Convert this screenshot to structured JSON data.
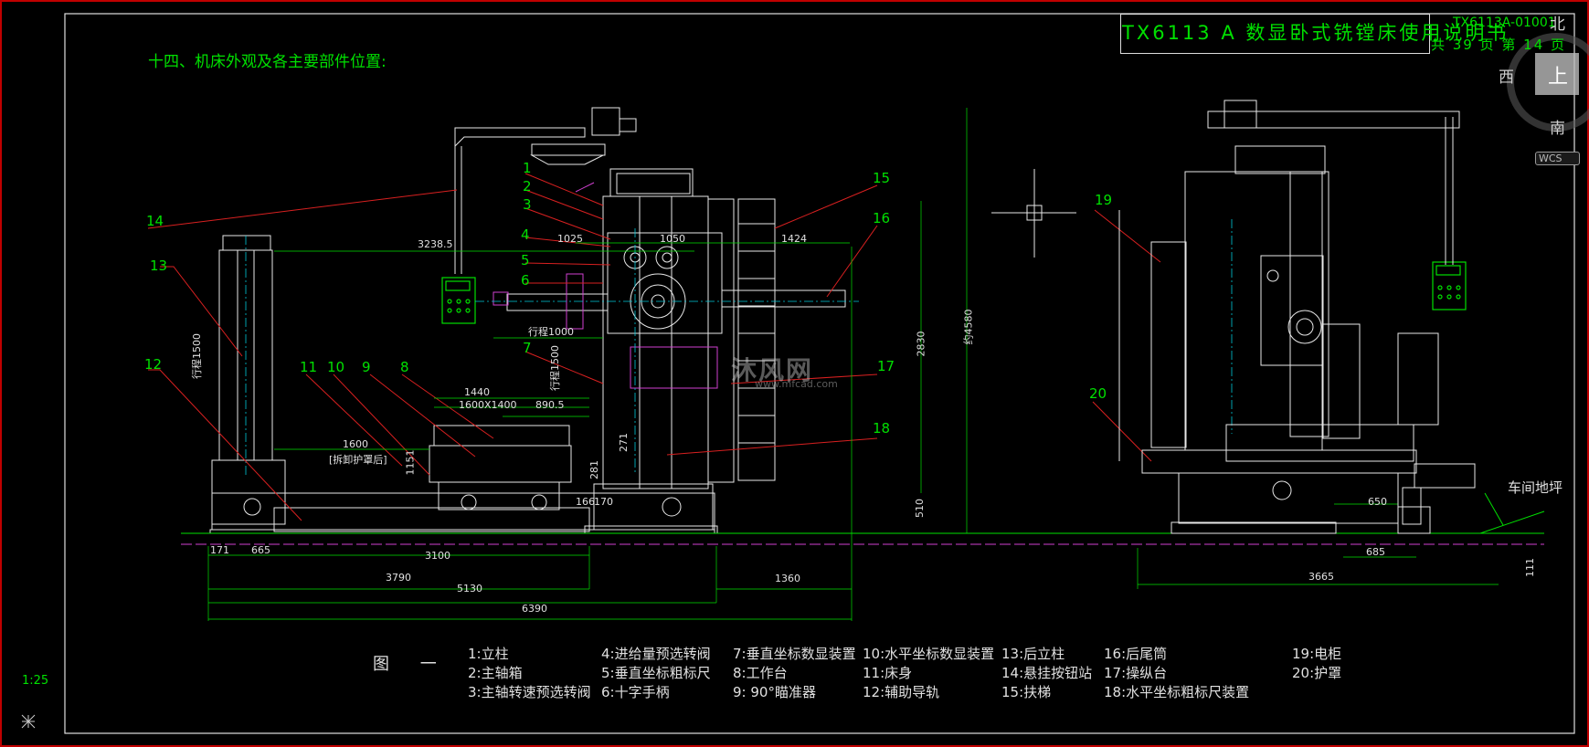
{
  "title": {
    "main": "TX6113 A 数显卧式铣镗床使用说明书",
    "code": "TX6113A-01001",
    "pages": "共 39 页   第 14 页"
  },
  "heading": "十四、机床外观及各主要部件位置:",
  "figure_label": "图 一",
  "scale": "1:25",
  "compass": {
    "north": "北",
    "west": "西",
    "south": "南",
    "top": "上",
    "wcs": "WCS"
  },
  "watermark": {
    "main": "沐风网",
    "url": "www.mfcad.com"
  },
  "ground_label": "车间地坪",
  "callouts": [
    "1",
    "2",
    "3",
    "4",
    "5",
    "6",
    "7",
    "8",
    "9",
    "10",
    "11",
    "12",
    "13",
    "14",
    "15",
    "16",
    "17",
    "18",
    "19",
    "20"
  ],
  "dimensions": {
    "d3238": "3238.5",
    "d1025": "1025",
    "d1050": "1050",
    "d1424": "1424",
    "d1440": "1440",
    "d1600x1400": "1600X1400",
    "d890": "890.5",
    "d1600": "1600",
    "d1600sub": "[拆卸护罩后]",
    "d166": "166",
    "d170": "170",
    "d171": "171",
    "d665": "665",
    "d3100": "3100",
    "d3790": "3790",
    "d5130": "5130",
    "d1360": "1360",
    "d6390": "6390",
    "d2830": "2830",
    "d4580": "约4580",
    "d510": "510",
    "d1151": "1151",
    "d281": "281",
    "d271": "271",
    "d3665": "3665",
    "d650": "650",
    "d685": "685",
    "d111": "111",
    "travel_x": "行程1000",
    "travel_y": "行程1500",
    "travel_col": "行程1500"
  },
  "legend": {
    "col1": [
      "1:立柱",
      "2:主轴箱",
      "3:主轴转速预选转阀"
    ],
    "col2": [
      "4:进给量预选转阀",
      "5:垂直坐标粗标尺",
      "6:十字手柄"
    ],
    "col3": [
      "7:垂直坐标数显装置",
      "8:工作台",
      "9: 90°瞄准器"
    ],
    "col4": [
      "10:水平坐标数显装置",
      "11:床身",
      "12:辅助导轨"
    ],
    "col5": [
      "13:后立柱",
      "14:悬挂按钮站",
      "15:扶梯"
    ],
    "col6": [
      "16:后尾筒",
      "17:操纵台",
      "18:水平坐标粗标尺装置"
    ],
    "col7": [
      "19:电柜",
      "20:护罩"
    ]
  }
}
